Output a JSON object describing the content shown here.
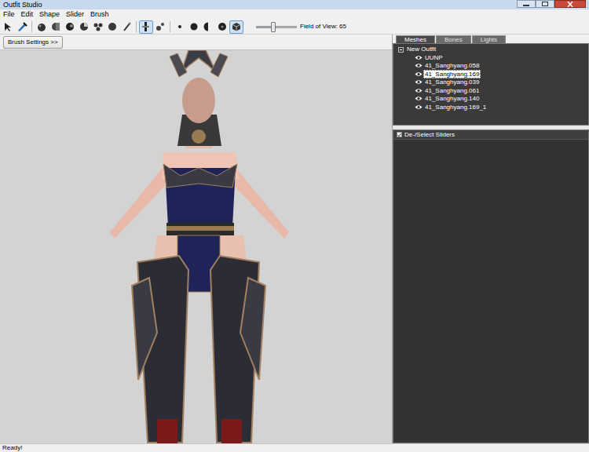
{
  "window": {
    "title": "Outfit Studio"
  },
  "menu": [
    "File",
    "Edit",
    "Shape",
    "Slider",
    "Brush"
  ],
  "toolbar": {
    "groups": [
      [
        {
          "selected": false
        },
        {
          "selected": false
        }
      ],
      [
        {
          "selected": false
        },
        {
          "selected": false
        },
        {
          "selected": false
        },
        {
          "selected": false
        },
        {
          "selected": false
        },
        {
          "selected": false
        },
        {
          "selected": false
        }
      ],
      [
        {
          "selected": true
        },
        {
          "selected": false
        }
      ],
      [
        {
          "selected": false
        },
        {
          "selected": false
        },
        {
          "selected": false
        },
        {
          "selected": false
        },
        {
          "selected": true
        }
      ]
    ],
    "fov": {
      "label": "Field of View: 65",
      "level": 0.42
    }
  },
  "brush_settings_button": "Brush Settings >>",
  "tabs": [
    {
      "label": "Meshes",
      "selected": true
    },
    {
      "label": "Bones",
      "selected": false
    },
    {
      "label": "Lights",
      "selected": false
    }
  ],
  "tree": {
    "root": {
      "label": "New Outfit",
      "expanded": true
    },
    "items": [
      {
        "label": "UUNP",
        "visible": true,
        "selected": false
      },
      {
        "label": "41_Sanghyang.058",
        "visible": true,
        "selected": false
      },
      {
        "label": "41_Sanghyang.169",
        "visible": true,
        "selected": true
      },
      {
        "label": "41_Sanghyang.039",
        "visible": true,
        "selected": false
      },
      {
        "label": "41_Sanghyang.061",
        "visible": true,
        "selected": false
      },
      {
        "label": "41_Sanghyang.140",
        "visible": true,
        "selected": false
      },
      {
        "label": "41_Sanghyang.169_1",
        "visible": true,
        "selected": false
      }
    ]
  },
  "sliders_panel": {
    "label": "De-/Select Sliders",
    "checked": true
  },
  "status_bar": "Ready!"
}
